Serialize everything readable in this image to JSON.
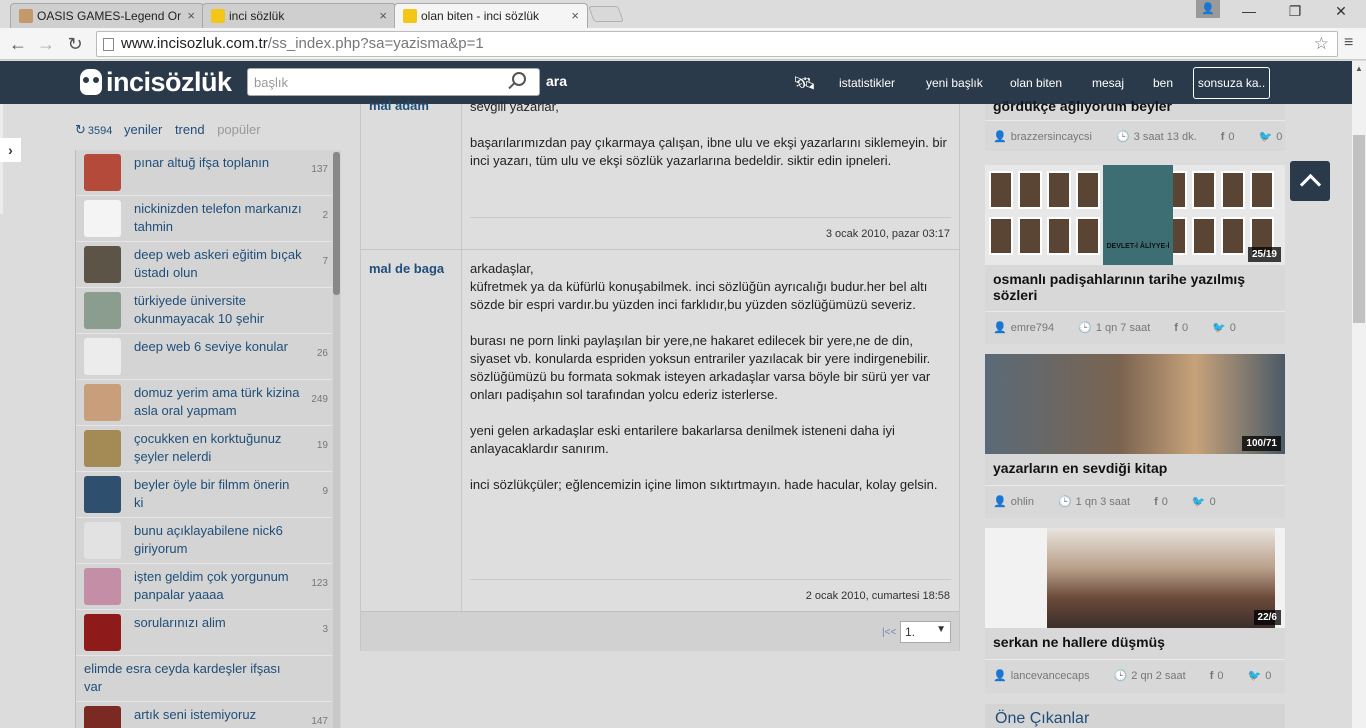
{
  "browser": {
    "tabs": [
      {
        "title": "OASIS GAMES-Legend Or",
        "color": "#c49a6c"
      },
      {
        "title": "inci sözlük",
        "color": "#f5c518"
      },
      {
        "title": "olan biten - inci sözlük",
        "color": "#f5c518"
      }
    ],
    "close_glyph": "×",
    "url_host": "www.incisozluk.com.tr",
    "url_path": "/ss_index.php?sa=yazisma&p=1"
  },
  "header": {
    "logo": "incisözlük",
    "search_placeholder": "başlık",
    "search_button": "ara",
    "nav": [
      "istatistikler",
      "yeni başlık",
      "olan biten",
      "mesaj",
      "ben"
    ],
    "nav_button": "sonsuza ka.."
  },
  "left": {
    "count": "3594",
    "tabs": [
      "yeniler",
      "trend",
      "popüler"
    ],
    "topics": [
      {
        "title": "pınar altuğ ifşa toplanın",
        "count": "137",
        "thumb": "#b44a3a"
      },
      {
        "title": "nickinizden telefon markanızı tahmin",
        "count": "2",
        "thumb": "#f4f4f4"
      },
      {
        "title": "deep web askeri eğitim bıçak üstadı olun",
        "count": "7",
        "thumb": "#5c5547"
      },
      {
        "title": "türkiyede üniversite okunmayacak 10 şehir",
        "count": "",
        "thumb": "#8a9d8e"
      },
      {
        "title": "deep web 6 seviye konular",
        "count": "26",
        "thumb": "#ececec"
      },
      {
        "title": "domuz yerim ama türk kizina asla oral yapmam",
        "count": "249",
        "thumb": "#c89f7a"
      },
      {
        "title": "çocukken en korktuğunuz şeyler nelerdi",
        "count": "19",
        "thumb": "#a48a55"
      },
      {
        "title": "beyler öyle bir filmm önerin ki",
        "count": "9",
        "thumb": "#2f4f6f"
      },
      {
        "title": "bunu açıklayabilene nick6 giriyorum",
        "count": "",
        "thumb": "#e2e2e2"
      },
      {
        "title": "işten geldim çok yorgunum panpalar yaaaa",
        "count": "123",
        "thumb": "#c48fa6"
      },
      {
        "title": "sorularınızı alim",
        "count": "3",
        "thumb": "#8e1a1a"
      },
      {
        "title": "elimde esra ceyda kardeşler ifşası var",
        "count": "",
        "thumb": ""
      },
      {
        "title": "artık seni istemiyoruz",
        "count": "147",
        "thumb": "#7a2a22"
      }
    ]
  },
  "entries": [
    {
      "author": "mal adam",
      "text": "sevgili yazarlar,\n\nbaşarılarımızdan pay çıkarmaya çalışan, ibne ulu ve ekşi yazarlarını siklemeyin. bir inci yazarı, tüm ulu ve ekşi sözlük yazarlarına bedeldir. siktir edin ipneleri.",
      "date": "3 ocak 2010, pazar 03:17"
    },
    {
      "author": "mal de baga",
      "text": "arkadaşlar,\nküfretmek ya da küfürlü konuşabilmek. inci sözlüğün ayrıcalığı budur.her bel altı sözde bir espri vardır.bu yüzden inci farklıdır,bu yüzden sözlüğümüzü severiz.\n\nburası ne porn linki paylaşılan bir yere,ne hakaret edilecek bir yere,ne de din, siyaset vb. konularda espriden yoksun entrariler yazılacak bir yere indirgenebilir. sözlüğümüzü bu formata sokmak isteyen arkadaşlar varsa böyle bir sürü yer var onları padişahın sol tarafından yolcu ederiz isterlerse.\n\nyeni gelen arkadaşlar eski entarilere bakarlarsa denilmek isteneni daha iyi anlayacaklardır sanırım.\n\ninci sözlükçüler; eğlencemizin içine limon sıktırtmayın. hade hacular, kolay gelsin.",
      "date": "2 ocak 2010, cumartesi 18:58"
    }
  ],
  "pager": {
    "first": "|<<",
    "current": "1.",
    "caret": "▼"
  },
  "cards": [
    {
      "title": "gördükçe ağlıyorum beyler",
      "user": "brazzersincaycsi",
      "time": "3 saat 13 dk.",
      "fb": "0",
      "tw": "0",
      "badge": "",
      "img": ""
    },
    {
      "title": "osmanlı padişahlarının tarihe yazılmış sözleri",
      "user": "emre794",
      "time": "1 qn 7 saat",
      "fb": "0",
      "tw": "0",
      "badge": "25/19",
      "img": "#3d6e73",
      "img_text": "DEVLET-İ ÂLİYYE-İ"
    },
    {
      "title": "yazarların en sevdiği kitap",
      "user": "ohlin",
      "time": "1 qn 3 saat",
      "fb": "0",
      "tw": "0",
      "badge": "100/71",
      "img": "#5a6a78"
    },
    {
      "title": "serkan ne hallere düşmüş",
      "user": "lancevancecaps",
      "time": "2 qn 2 saat",
      "fb": "0",
      "tw": "0",
      "badge": "22/6",
      "img": "#ececec"
    }
  ],
  "featured_title": "Öne Çıkanlar",
  "icons": {
    "user": "👤",
    "clock": "🕒",
    "facebook": "f",
    "twitter": "🐦",
    "back": "←",
    "forward": "→",
    "reload": "↻",
    "star": "☆",
    "menu": "≡",
    "minimize": "—",
    "restore": "❐",
    "close": "✕",
    "satellite": "🛰",
    "refresh": "↻",
    "chevron": "›"
  }
}
